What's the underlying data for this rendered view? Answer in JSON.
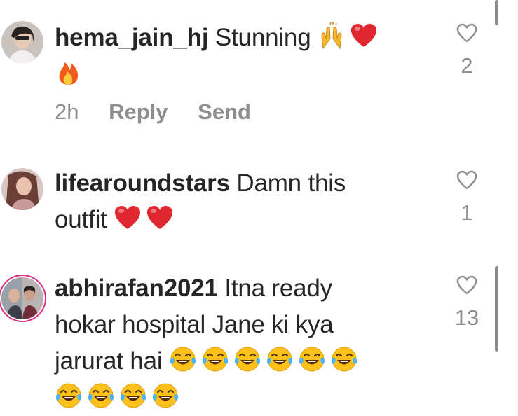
{
  "comments": [
    {
      "username": "hema_jain_hj",
      "text": "Stunning",
      "emojis_inline": [
        "raising-hands-emoji",
        "red-heart-emoji"
      ],
      "emojis_wrap": [
        "fire-emoji"
      ],
      "time": "2h",
      "reply_label": "Reply",
      "send_label": "Send",
      "likes": "2"
    },
    {
      "username": "lifearoundstars",
      "text_line1": "Damn this",
      "text_line2": "outfit",
      "emojis": [
        "red-heart-emoji",
        "red-heart-emoji"
      ],
      "likes": "1"
    },
    {
      "username": "abhirafan2021",
      "text_line1": "Itna ready",
      "text_line2": "hokar hospital Jane ki kya",
      "text_line3": "jarurat hai",
      "emojis": [
        "tears-of-joy-emoji",
        "tears-of-joy-emoji",
        "tears-of-joy-emoji",
        "tears-of-joy-emoji",
        "tears-of-joy-emoji",
        "tears-of-joy-emoji",
        "tears-of-joy-emoji",
        "tears-of-joy-emoji",
        "tears-of-joy-emoji",
        "tears-of-joy-emoji"
      ],
      "likes": "13"
    }
  ],
  "colors": {
    "text": "#262626",
    "secondary": "#8e8e8e",
    "story_ring": "#d92e7f",
    "heart": "#e0262f"
  }
}
